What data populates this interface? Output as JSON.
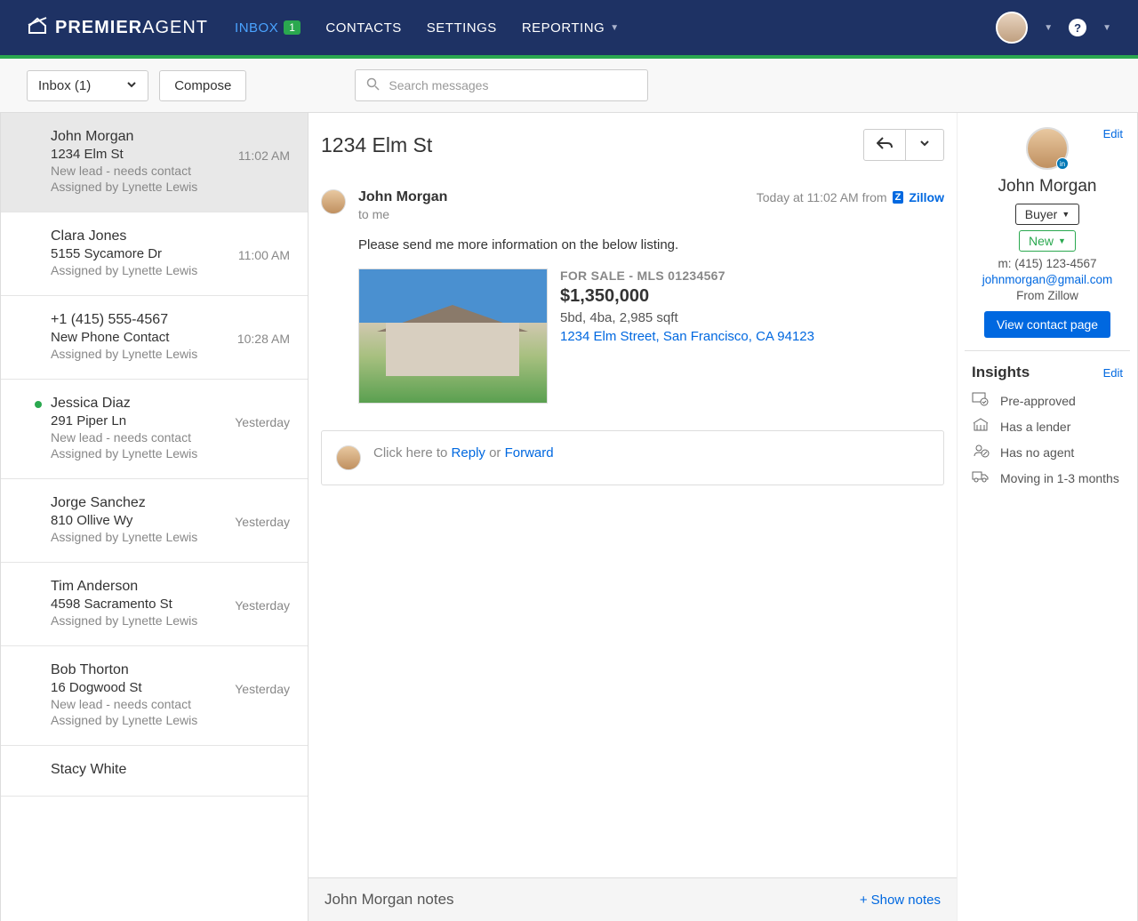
{
  "brand": {
    "logo_thin": "PREMIER",
    "logo_bold": "AGENT"
  },
  "nav": {
    "inbox": "INBOX",
    "inbox_badge": "1",
    "contacts": "CONTACTS",
    "settings": "SETTINGS",
    "reporting": "REPORTING"
  },
  "toolbar": {
    "inbox_dropdown": "Inbox (1)",
    "compose": "Compose",
    "search_placeholder": "Search messages"
  },
  "messages": [
    {
      "name": "John Morgan",
      "addr": "1234 Elm St",
      "meta1": "New lead - needs contact",
      "meta2": "Assigned by Lynette Lewis",
      "time": "11:02 AM",
      "online": false
    },
    {
      "name": "Clara Jones",
      "addr": "5155 Sycamore Dr",
      "meta1": "",
      "meta2": "Assigned by Lynette Lewis",
      "time": "11:00 AM",
      "online": false
    },
    {
      "name": "+1 (415) 555-4567",
      "addr": "New Phone Contact",
      "meta1": "",
      "meta2": "Assigned by Lynette Lewis",
      "time": "10:28 AM",
      "online": false
    },
    {
      "name": "Jessica Diaz",
      "addr": "291 Piper Ln",
      "meta1": "New lead - needs contact",
      "meta2": "Assigned by Lynette Lewis",
      "time": "Yesterday",
      "online": true
    },
    {
      "name": "Jorge Sanchez",
      "addr": "810 Ollive Wy",
      "meta1": "",
      "meta2": "Assigned by Lynette Lewis",
      "time": "Yesterday",
      "online": false
    },
    {
      "name": "Tim Anderson",
      "addr": "4598 Sacramento St",
      "meta1": "",
      "meta2": "Assigned by Lynette Lewis",
      "time": "Yesterday",
      "online": false
    },
    {
      "name": "Bob Thorton",
      "addr": "16 Dogwood St",
      "meta1": "New lead - needs contact",
      "meta2": "Assigned by Lynette Lewis",
      "time": "Yesterday",
      "online": false
    },
    {
      "name": "Stacy White",
      "addr": "",
      "meta1": "",
      "meta2": "",
      "time": "",
      "online": false
    }
  ],
  "detail": {
    "title": "1234 Elm St",
    "from": "John Morgan",
    "timestamp_prefix": "Today at 11:02 AM from",
    "source": "Zillow",
    "to": "to me",
    "body": "Please send me more information on the below listing.",
    "listing": {
      "status": "FOR SALE - MLS 01234567",
      "price": "$1,350,000",
      "meta": "5bd, 4ba, 2,985 sqft",
      "addr": "1234 Elm Street, San Francisco, CA 94123"
    },
    "reply": {
      "prefix": "Click here to ",
      "reply": "Reply",
      "or": " or ",
      "forward": "Forward"
    },
    "notes_title": "John Morgan notes",
    "show_notes": "Show notes"
  },
  "sidebar": {
    "edit": "Edit",
    "name": "John Morgan",
    "chip_buyer": "Buyer",
    "chip_new": "New",
    "phone": "m: (415) 123-4567",
    "email": "johnmorgan@gmail.com",
    "source": "From Zillow",
    "view_contact": "View contact page",
    "insights_title": "Insights",
    "insights_edit": "Edit",
    "insights": [
      "Pre-approved",
      "Has a lender",
      "Has no agent",
      "Moving in 1-3 months"
    ]
  }
}
